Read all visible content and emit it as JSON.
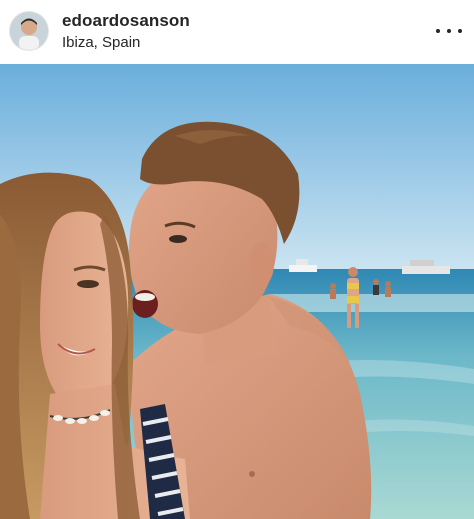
{
  "post": {
    "header": {
      "username": "edoardosanson",
      "location": "Ibiza, Spain",
      "avatar_icon": "profile-avatar",
      "more_icon": "more-options-icon"
    },
    "photo": {
      "scene": "beach-selfie"
    }
  },
  "colors": {
    "text": "#262626",
    "sky": "#8fc3e3",
    "sea": "#3e93b5",
    "shallow_water": "#9fd1d3",
    "skin": "#e0a489"
  }
}
